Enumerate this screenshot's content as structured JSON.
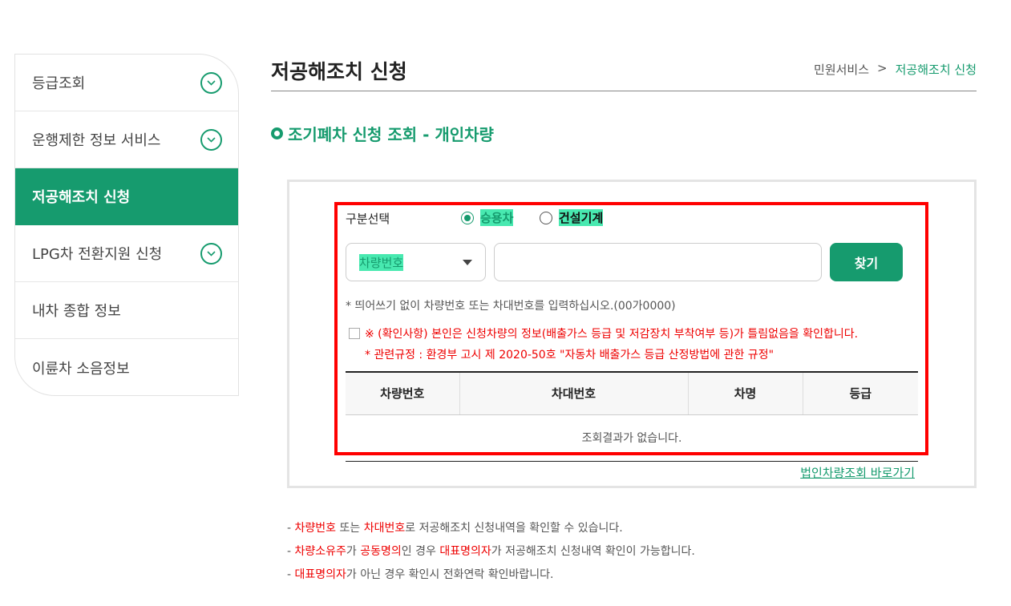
{
  "sidebar": {
    "items": [
      {
        "label": "등급조회",
        "expandable": true
      },
      {
        "label": "운행제한 정보 서비스",
        "expandable": true
      },
      {
        "label": "저공해조치 신청",
        "active": true
      },
      {
        "label": "LPG차 전환지원 신청",
        "expandable": true
      },
      {
        "label": "내차 종합 정보"
      },
      {
        "label": "이륜차 소음정보"
      }
    ]
  },
  "header": {
    "title": "저공해조치 신청",
    "breadcrumb": [
      "민원서비스",
      ">",
      "저공해조치 신청"
    ]
  },
  "section": {
    "title": "조기폐차 신청 조회 - 개인차량"
  },
  "form": {
    "category_label": "구분선택",
    "radio_options": [
      {
        "label": "승용차",
        "checked": true
      },
      {
        "label": "건설기계",
        "checked": false
      }
    ],
    "search_type": "차량번호",
    "search_input_value": "",
    "search_button": "찾기",
    "hint": "* 띄어쓰기 없이 차량번호 또는 차대번호를 입력하십시오.(00가0000)",
    "confirm_text": "※ (확인사항) 본인은 신청차량의 정보(배출가스 등급 및 저감장치 부착여부 등)가 틀림없음을 확인합니다.",
    "rule_text": "* 관련규정 : 환경부 고시 제 2020-50호 \"자동차 배출가스 등급 산정방법에 관한 규정\""
  },
  "table": {
    "headers": [
      "차량번호",
      "차대번호",
      "차명",
      "등급"
    ],
    "empty_message": "조회결과가 없습니다."
  },
  "corp_link": "법인차량조회 바로가기",
  "notes": [
    {
      "p1": "- ",
      "r1": "차량번호",
      "p2": " 또는 ",
      "r2": "차대번호",
      "p3": "로 저공해조치 신청내역을 확인할 수 있습니다."
    },
    {
      "p1": "- ",
      "r1": "차량소유주",
      "p2": "가 ",
      "r2": "공동명의",
      "p3": "인 경우 ",
      "r3": "대표명의자",
      "p4": "가 저공해조치 신청내역 확인이 가능합니다."
    },
    {
      "p1": "- ",
      "r1": "대표명의자",
      "p2": "가 아닌 경우 확인시 전화연락 확인바랍니다."
    }
  ],
  "colors": {
    "brand": "#169b6e",
    "alert": "#ee0000",
    "highlight": "#48e9b0"
  }
}
